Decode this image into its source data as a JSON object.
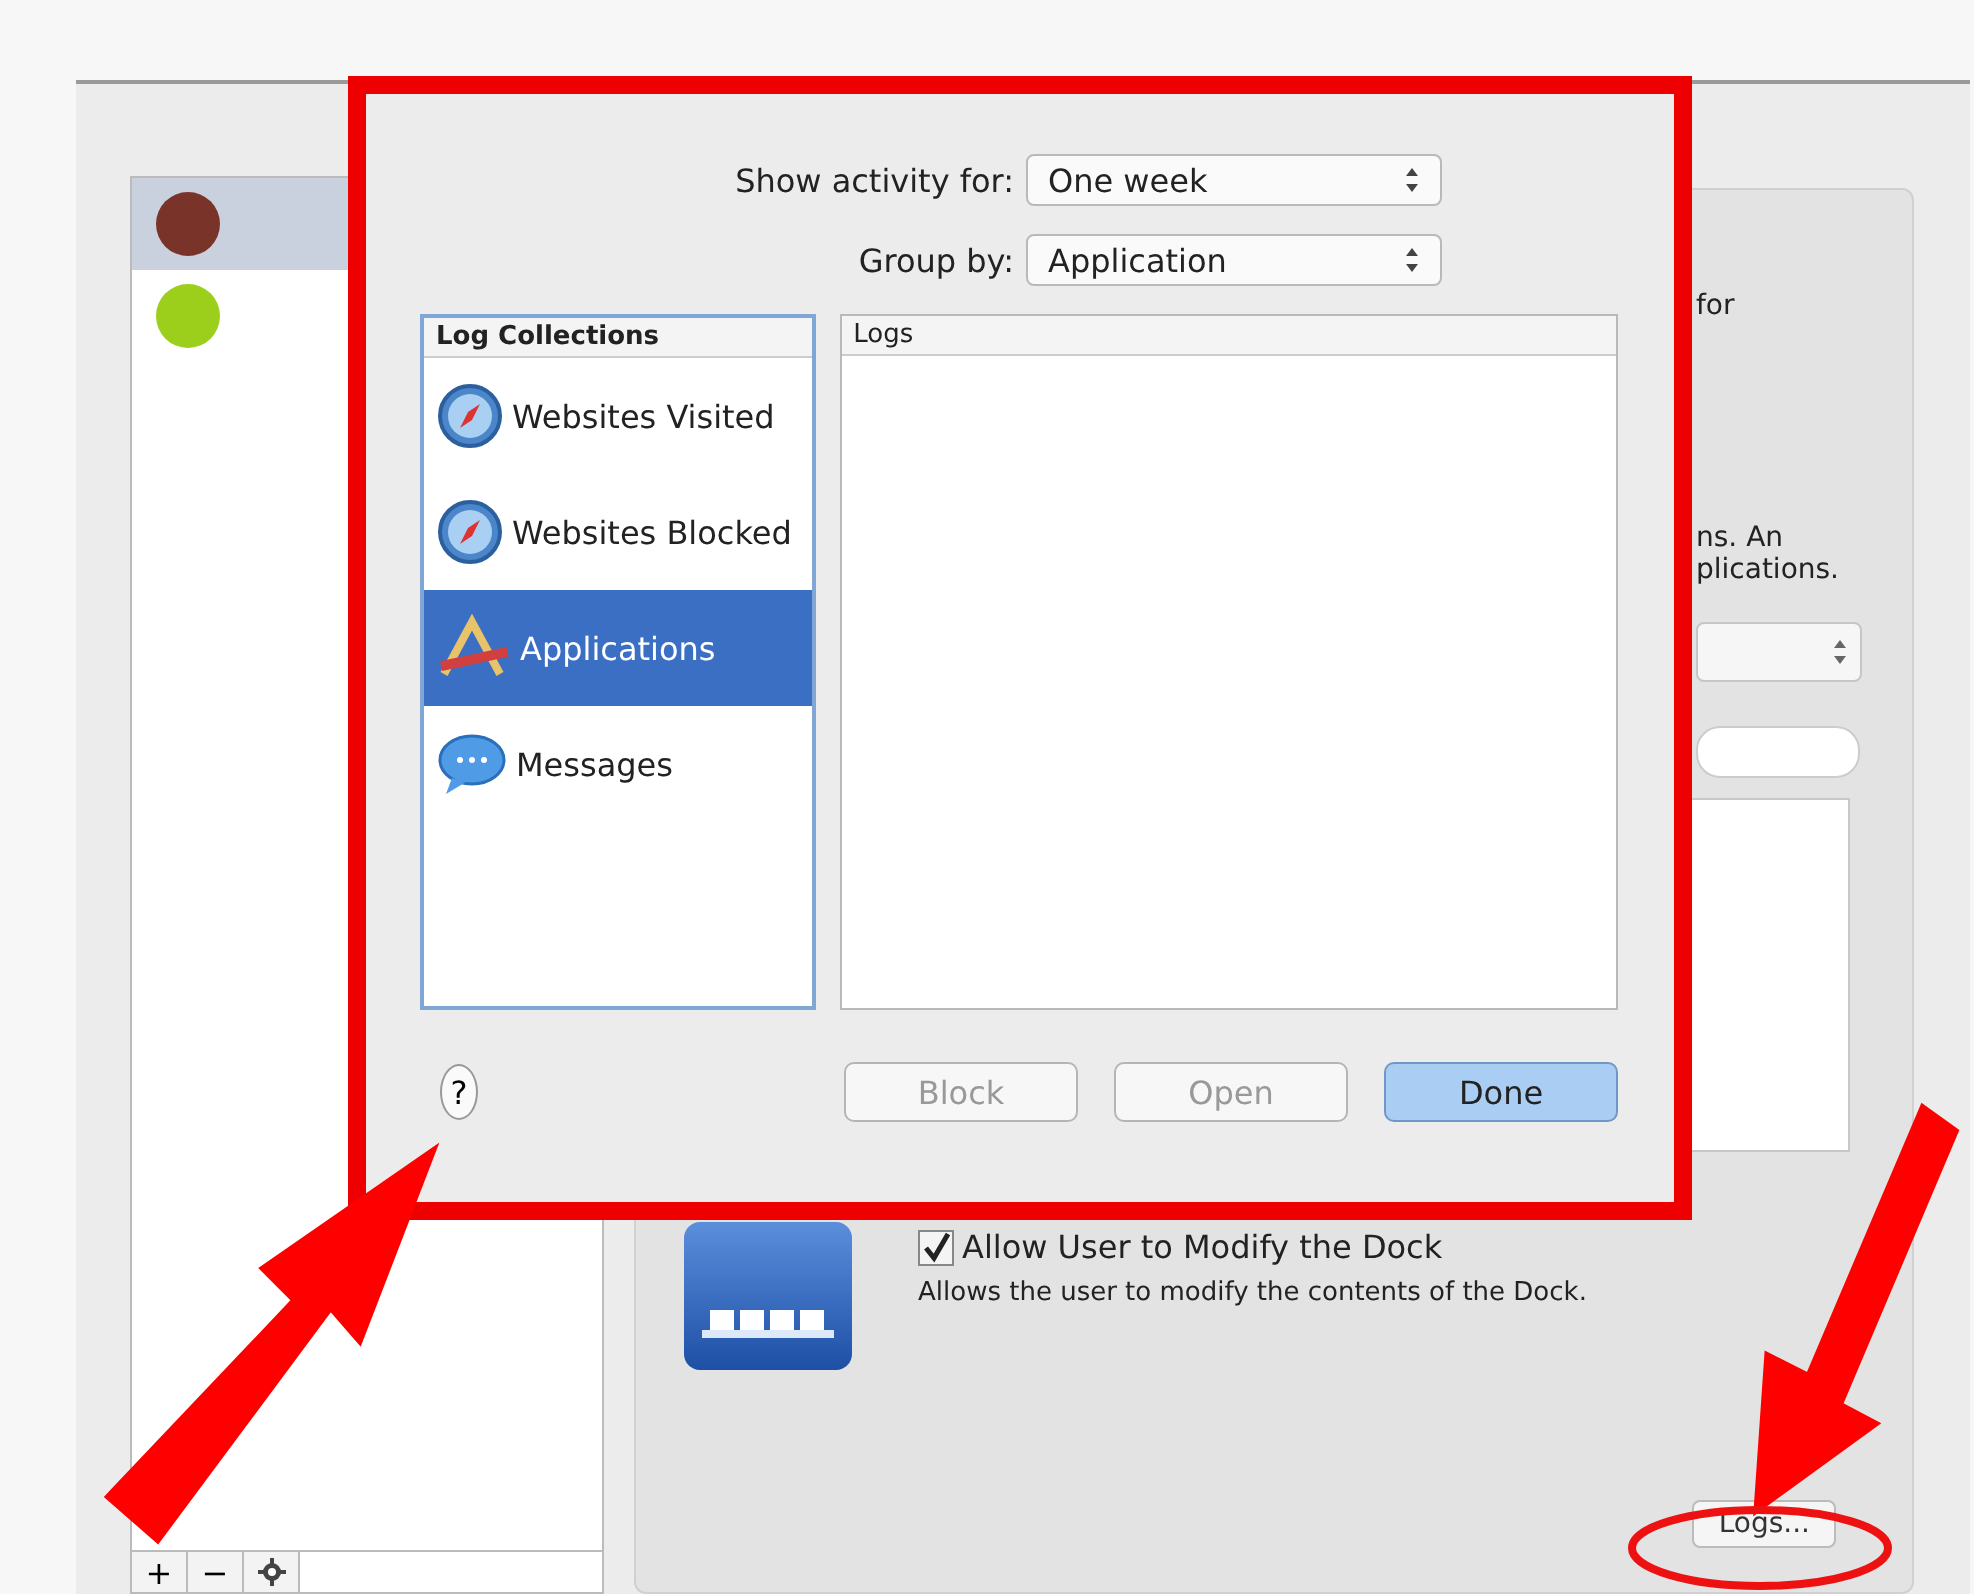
{
  "sidebar": {
    "users": [
      {
        "selected": true
      },
      {
        "selected": false
      }
    ],
    "buttons": [
      "+",
      "−"
    ]
  },
  "main": {
    "fragments": [
      "for",
      "ns. An",
      "plications."
    ],
    "dock": {
      "label": "Allow User to Modify the Dock",
      "checked": true,
      "description": "Allows the user to modify the contents of the Dock."
    },
    "logs_button": "Logs..."
  },
  "sheet": {
    "show_activity": {
      "label": "Show activity for:",
      "value": "One week"
    },
    "group_by": {
      "label": "Group by:",
      "value": "Application"
    },
    "collections": {
      "header": "Log Collections",
      "items": [
        {
          "label": "Websites Visited",
          "kind": "compass",
          "selected": false
        },
        {
          "label": "Websites Blocked",
          "kind": "compass",
          "selected": false
        },
        {
          "label": "Applications",
          "kind": "appstore",
          "selected": true
        },
        {
          "label": "Messages",
          "kind": "messages",
          "selected": false
        }
      ]
    },
    "logs": {
      "header": "Logs"
    },
    "help": "?",
    "buttons": [
      {
        "label": "Block",
        "disabled": true,
        "default": false
      },
      {
        "label": "Open",
        "disabled": true,
        "default": false
      },
      {
        "label": "Done",
        "disabled": false,
        "default": true
      }
    ]
  }
}
